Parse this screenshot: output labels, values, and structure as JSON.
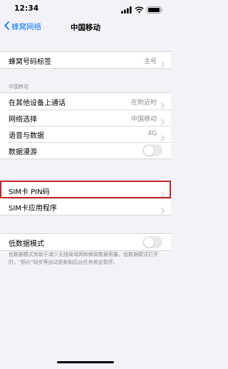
{
  "status_bar": {
    "time": "12:34",
    "icons": [
      "cellular-signal-icon",
      "wifi-icon",
      "battery-icon"
    ]
  },
  "nav": {
    "back_label": "蜂窝网络",
    "title": "中国移动"
  },
  "label_group": {
    "label": "蜂窝号码标签",
    "value": "主号"
  },
  "carrier_section": {
    "header": "中国移动",
    "rows": [
      {
        "label": "在其他设备上通话",
        "value": "在附近时"
      },
      {
        "label": "网络选择",
        "value": "中国移动"
      },
      {
        "label": "语音与数据",
        "value": "4G"
      },
      {
        "label": "数据漫游",
        "toggle": false
      }
    ]
  },
  "sim_group": {
    "rows": [
      {
        "label": "SIM卡 PIN码",
        "highlighted": true
      },
      {
        "label": "SIM卡应用程序"
      }
    ]
  },
  "low_data_group": {
    "label": "低数据模式",
    "toggle": false,
    "footer": "低数据模式有助于减少无线局域网和蜂窝数据用量。低数据模式打开时，\"照片\"同步等自动更新和后台任务将会暂停。"
  },
  "colors": {
    "accent": "#0a7aff",
    "background": "#f2f2f7",
    "secondary_text": "#8a8a8e",
    "highlight": "#c0232b"
  }
}
